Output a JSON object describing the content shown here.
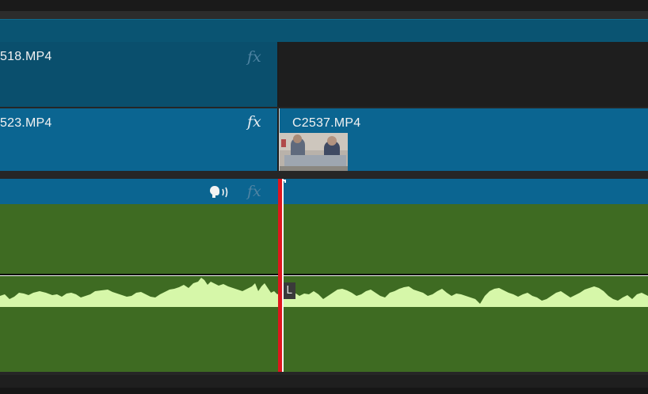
{
  "timeline": {
    "video_track_2": {
      "clips": [
        {
          "name": "518.MP4",
          "fx_label": "fx"
        }
      ]
    },
    "video_track_1": {
      "clips": [
        {
          "name": "523.MP4",
          "fx_label": "fx"
        },
        {
          "name": "C2537.MP4"
        }
      ]
    },
    "audio_track_1": {
      "fx_label": "fx",
      "channel_label": "L"
    }
  },
  "colors": {
    "video_clip": "#0b6591",
    "audio_clip": "#3e6b22",
    "waveform": "#d6f7a9",
    "playhead": "#e0151d"
  }
}
